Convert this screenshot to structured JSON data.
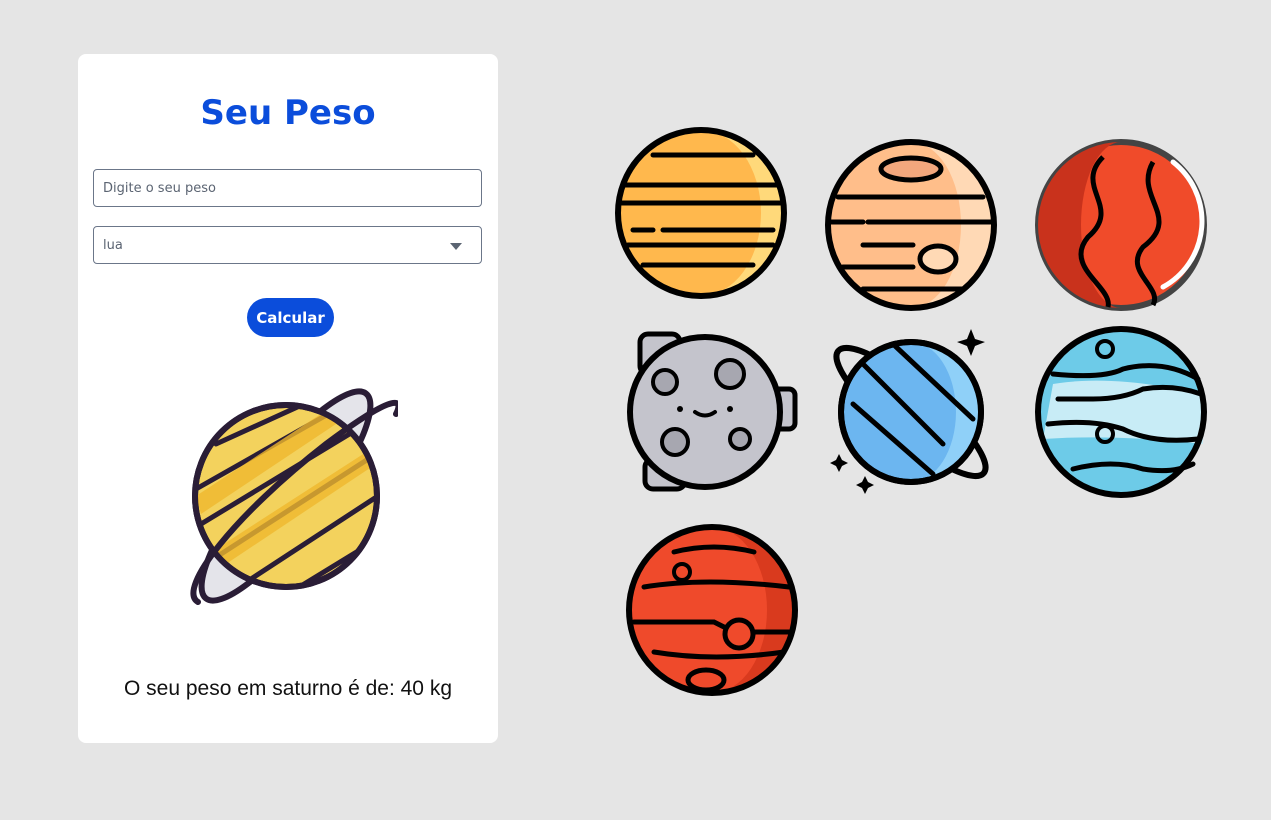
{
  "form": {
    "title": "Seu Peso",
    "weight_placeholder": "Digite o seu peso",
    "planet_selected": "lua",
    "calculate_label": "Calcular"
  },
  "result_text": "O seu peso em saturno é de: 40 kg",
  "colors": {
    "accent": "#0b4ddb",
    "background": "#e5e5e5",
    "card": "#ffffff"
  },
  "icons": [
    "saturn-icon",
    "jupiter-yellow-icon",
    "venus-icon",
    "mars-icon",
    "moon-icon",
    "uranus-icon",
    "neptune-icon",
    "jupiter-red-icon"
  ]
}
